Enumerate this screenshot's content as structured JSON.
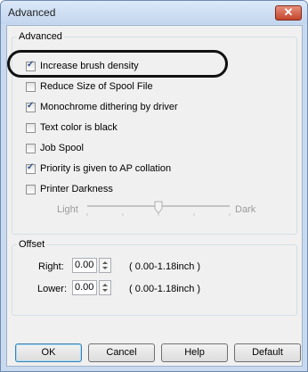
{
  "window": {
    "title": "Advanced",
    "close_glyph": "✕"
  },
  "advanced_group": {
    "title": "Advanced",
    "options": [
      {
        "label": "Increase brush density",
        "checked": true
      },
      {
        "label": "Reduce Size of Spool File",
        "checked": false
      },
      {
        "label": "Monochrome dithering by driver",
        "checked": true
      },
      {
        "label": "Text color is black",
        "checked": false
      },
      {
        "label": "Job Spool",
        "checked": false
      },
      {
        "label": "Priority is given to AP collation",
        "checked": true
      },
      {
        "label": "Printer Darkness",
        "checked": false
      }
    ],
    "darkness": {
      "light_label": "Light",
      "dark_label": "Dark",
      "level": 0.5
    }
  },
  "offset_group": {
    "title": "Offset",
    "right": {
      "label": "Right:",
      "value": "0.00",
      "range": "( 0.00-1.18inch )"
    },
    "lower": {
      "label": "Lower:",
      "value": "0.00",
      "range": "( 0.00-1.18inch )"
    }
  },
  "buttons": {
    "ok": "OK",
    "cancel": "Cancel",
    "help": "Help",
    "default": "Default"
  }
}
